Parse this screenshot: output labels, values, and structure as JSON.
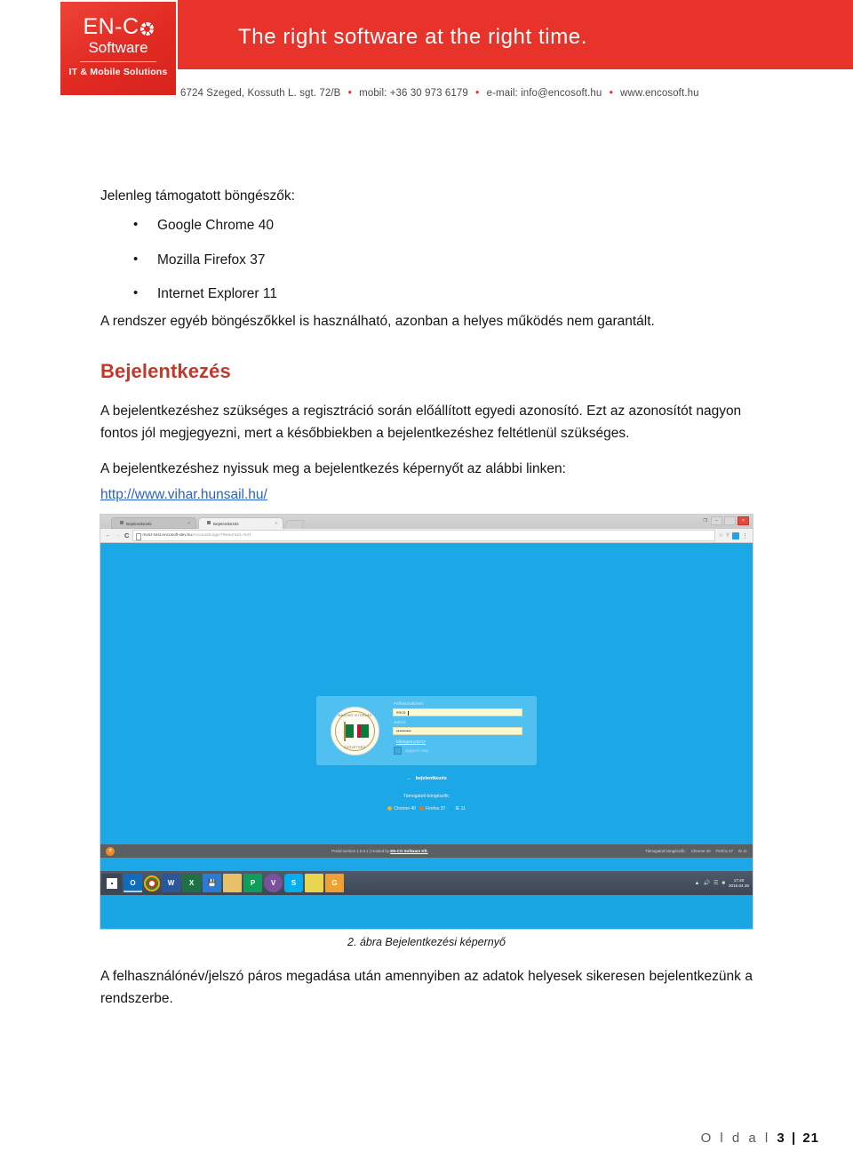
{
  "header": {
    "logo": {
      "main": "EN-C",
      "circle_icon": "enco-circle-icon",
      "sub": "Software",
      "tagline": "IT &  Mobile Solutions"
    },
    "slogan": "The right software at the right time.",
    "contact": {
      "address": "6724 Szeged, Kossuth L. sgt. 72/B",
      "mobile": "mobil: +36 30 973 6179",
      "email": "e-mail: info@encosoft.hu",
      "web": "www.encosoft.hu",
      "separator": "•"
    },
    "brand_red": "#e8332a"
  },
  "document": {
    "intro_heading": "Jelenleg támogatott böngészők:",
    "browsers": [
      "Google Chrome 40",
      "Mozilla Firefox 37",
      "Internet Explorer 11"
    ],
    "note": "A rendszer egyéb böngészőkkel is használható, azonban a helyes működés nem garantált.",
    "section_title": "Bejelentkezés",
    "section_color": "#c0392b",
    "paragraph_1": "A bejelentkezéshez szükséges a regisztráció során előállított egyedi azonosító. Ezt az azonosítót nagyon fontos jól megjegyezni, mert a későbbiekben a bejelentkezéshez feltétlenül szükséges.",
    "paragraph_2": "A bejelentkezéshez nyissuk meg a bejelentkezés képernyőt az alábbi linken:",
    "link_text": "http://www.vihar.hunsail.hu/",
    "figure_caption": "2. ábra Bejelentkezési képernyő",
    "paragraph_3": "A felhasználónév/jelszó páros megadása után amennyiben az adatok helyesek sikeresen bejelentkezünk a rendszerbe.",
    "footer_label": "O l d a l",
    "footer_page": "3",
    "footer_sep": "|",
    "footer_total": "21"
  },
  "screenshot": {
    "browser": {
      "tab_inactive_title": "Bejelentkezés",
      "tab_active_title": "Bejelentkezés",
      "tab_close": "×",
      "back_icon": "←",
      "forward_icon": "→",
      "reload_icon": "C",
      "url_host": "mvsz-test.encosoft-dev.hu",
      "url_path": "/Account/Login?ReturnUrl=%2f",
      "bookmark_icon": "☆",
      "win_minimize": "–",
      "win_restore": "❐",
      "win_close": "×"
    },
    "login": {
      "crest_top_text": "MAGYAR VITORLÁS",
      "crest_bottom_text": "SZÖVETSÉG",
      "username_label": "Felhasználónév",
      "username_value": "enco",
      "password_label": "Jelszó",
      "password_value": "••••••••••",
      "forgot_link": "Elfelejtett jelszó?",
      "remember_label": "Jegyezz meg",
      "submit_label": "bejelentkezés",
      "submit_arrow": "→",
      "supported_label": "Támogatott böngészők:",
      "browser_chrome": "Chrome 40",
      "browser_firefox": "Firefox 37",
      "browser_ie": "IE 11"
    },
    "webfooter": {
      "help_icon": "?",
      "portal_text": "Portal version 1.0.0.1 | Hosted by ",
      "portal_host": "EN-CO Software Kft.",
      "supported_label": "Támogatott böngészők:",
      "browser_chrome": "Chrome 40",
      "browser_firefox": "Firefox 37",
      "browser_ie": "IE 11"
    },
    "taskbar": {
      "start_icon": "windows-start-icon",
      "items": [
        "outlook-icon",
        "chrome-icon",
        "word-icon",
        "excel-icon",
        "save-icon",
        "folder-icon",
        "publisher-icon",
        "viber-icon",
        "skype-icon",
        "notes-icon",
        "orange-app-icon"
      ],
      "tray_time": "17:40",
      "tray_date": "2015.04.26"
    }
  }
}
